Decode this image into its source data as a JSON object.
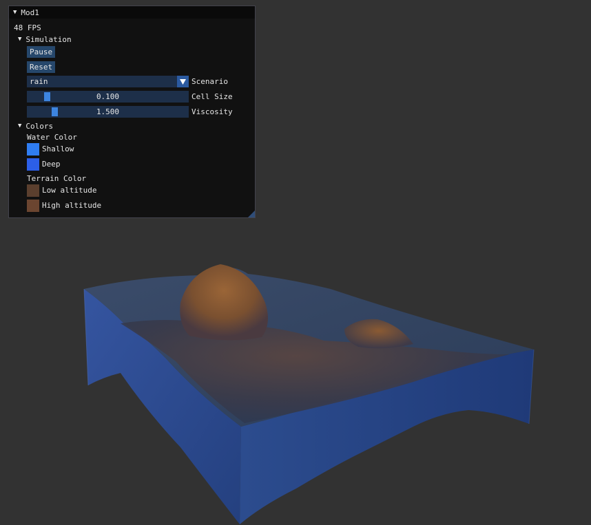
{
  "window": {
    "title": "Mod1",
    "fps": "48 FPS",
    "simulation": {
      "header": "Simulation",
      "pause_label": "Pause",
      "reset_label": "Reset",
      "scenario": {
        "value": "rain",
        "label": "Scenario"
      },
      "cell_size": {
        "value": "0.100",
        "label": "Cell Size",
        "level": 0.07
      },
      "viscosity": {
        "value": "1.500",
        "label": "Viscosity",
        "level": 0.12
      }
    },
    "colors": {
      "header": "Colors",
      "water_title": "Water Color",
      "shallow": {
        "label": "Shallow",
        "color": "#2f7df2"
      },
      "deep": {
        "label": "Deep",
        "color": "#2c5fe8"
      },
      "terrain_title": "Terrain Color",
      "low_altitude": {
        "label": "Low altitude",
        "color": "#5b3f2e"
      },
      "high_altitude": {
        "label": "High altitude",
        "color": "#6b4530"
      }
    }
  },
  "theme": {
    "background": "#323232",
    "water_side": "#2d4a86",
    "water_top": "#33486a",
    "terrain_peak": "#8a5a34"
  }
}
